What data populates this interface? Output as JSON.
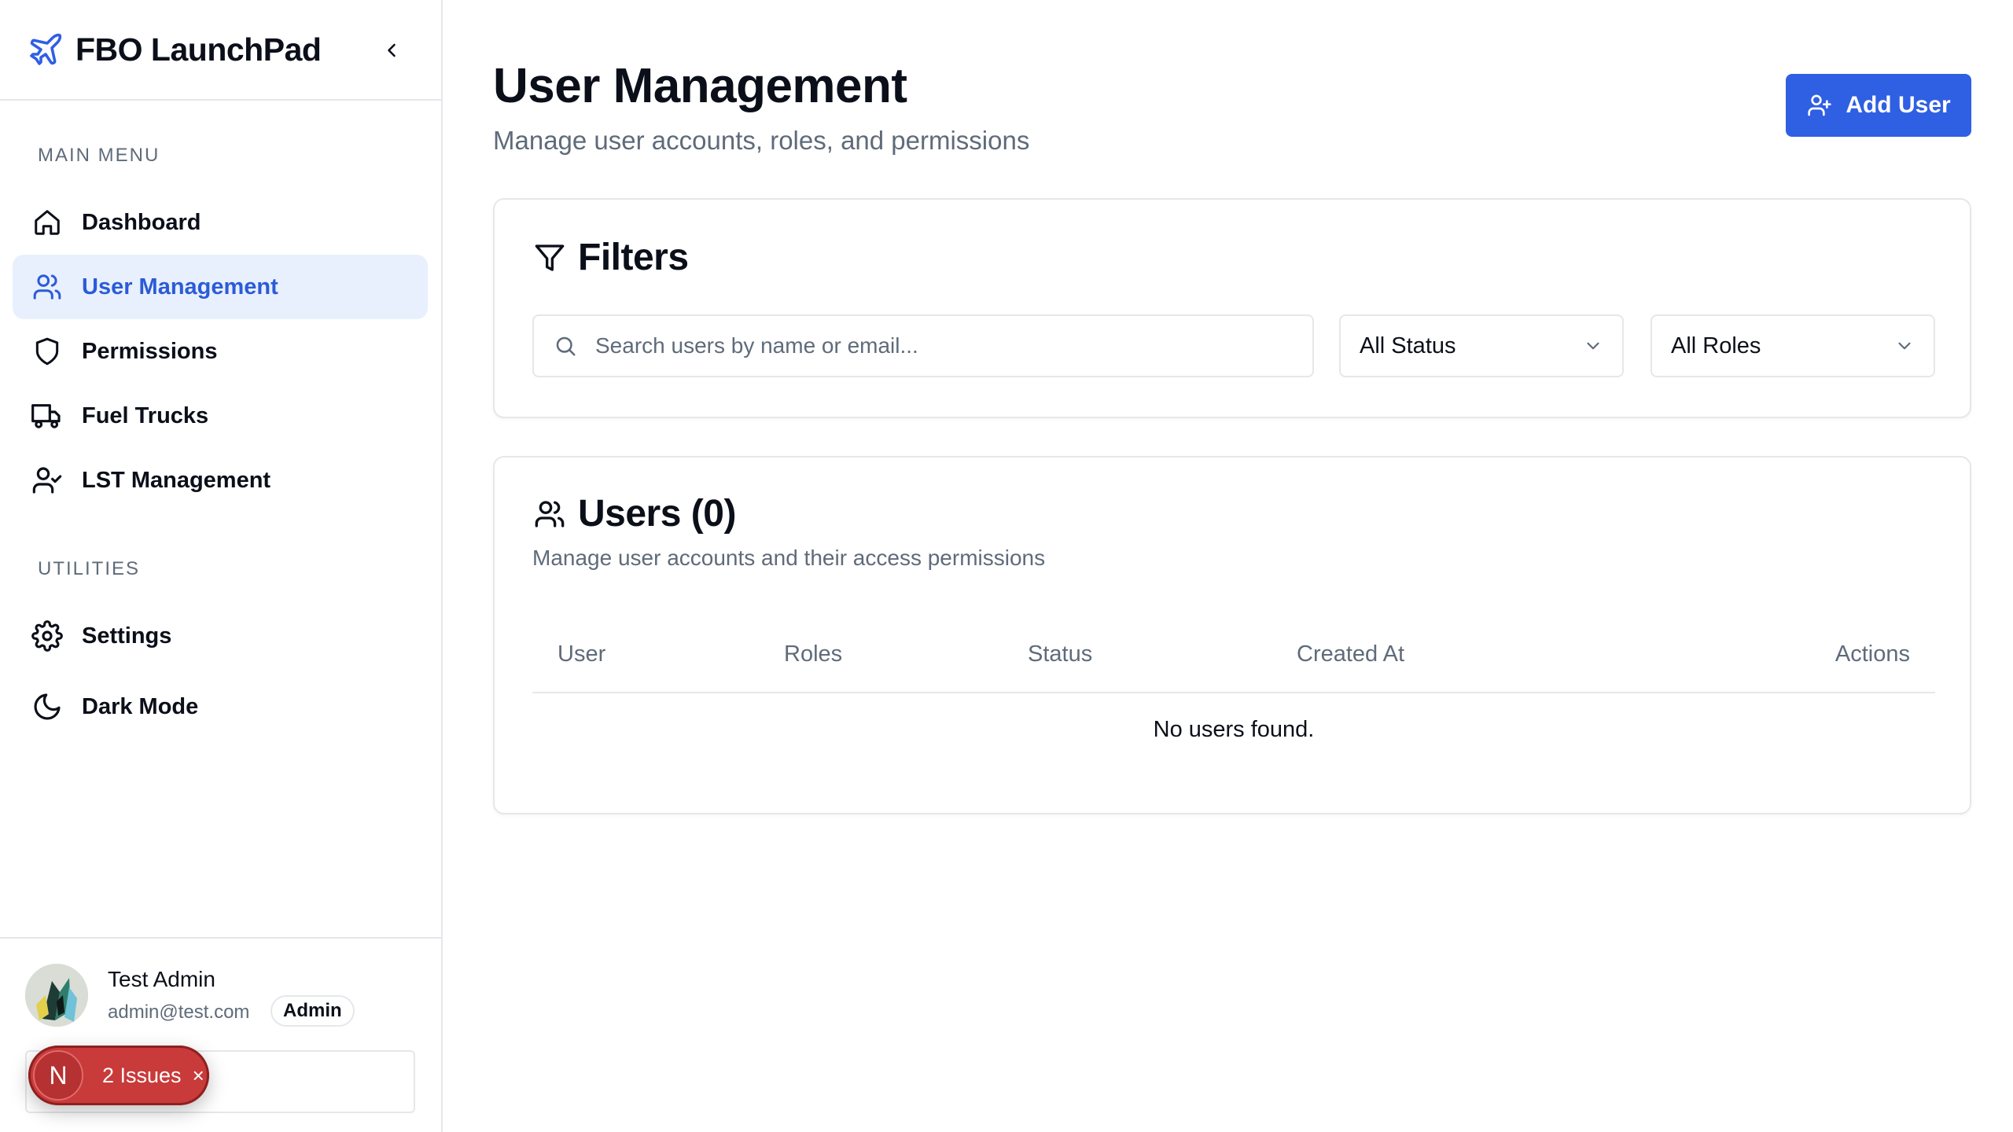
{
  "app": {
    "title": "FBO LaunchPad"
  },
  "sidebar": {
    "main_menu_label": "MAIN MENU",
    "items": [
      {
        "label": "Dashboard",
        "icon": "home-icon",
        "active": false
      },
      {
        "label": "User Management",
        "icon": "users-icon",
        "active": true
      },
      {
        "label": "Permissions",
        "icon": "shield-icon",
        "active": false
      },
      {
        "label": "Fuel Trucks",
        "icon": "truck-icon",
        "active": false
      },
      {
        "label": "LST Management",
        "icon": "user-check-icon",
        "active": false
      }
    ],
    "utilities_label": "UTILITIES",
    "utilities": [
      {
        "label": "Settings",
        "icon": "gear-icon"
      },
      {
        "label": "Dark Mode",
        "icon": "moon-icon"
      }
    ]
  },
  "user": {
    "name": "Test Admin",
    "email": "admin@test.com",
    "role": "Admin"
  },
  "issues": {
    "letter": "N",
    "label": "2 Issues",
    "close": "×"
  },
  "page": {
    "title": "User Management",
    "subtitle": "Manage user accounts, roles, and permissions",
    "add_button": "Add User"
  },
  "filters": {
    "title": "Filters",
    "search_placeholder": "Search users by name or email...",
    "status_value": "All Status",
    "role_value": "All Roles"
  },
  "users_card": {
    "title": "Users (0)",
    "subtitle": "Manage user accounts and their access permissions",
    "columns": [
      "User",
      "Roles",
      "Status",
      "Created At",
      "Actions"
    ],
    "empty": "No users found."
  },
  "colors": {
    "accent": "#2f5fe3",
    "active_bg": "#e8f0fe",
    "danger": "#c93a3a",
    "muted": "#5f6b7a"
  }
}
